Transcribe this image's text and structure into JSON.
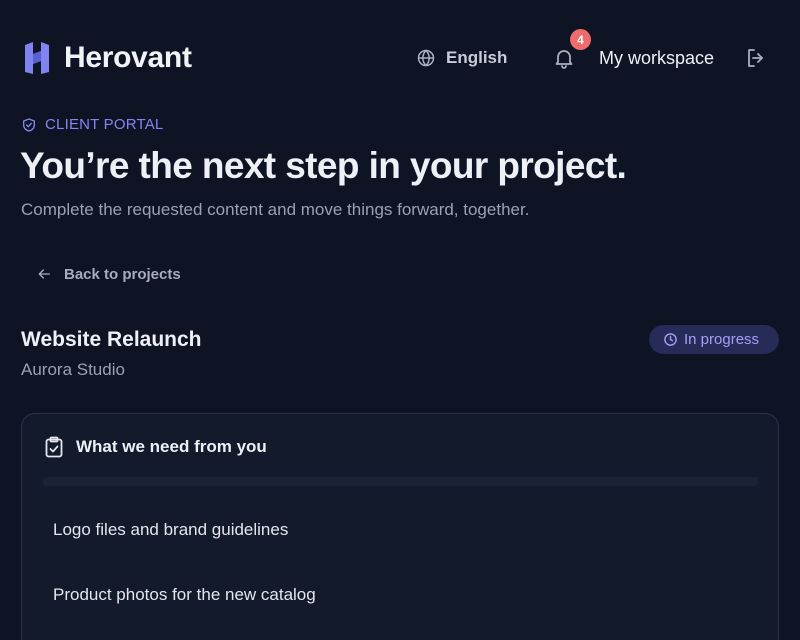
{
  "header": {
    "brand": "Herovant",
    "language": "English",
    "notifications_count": "4",
    "workspace_label": "My workspace"
  },
  "hero": {
    "eyebrow": "CLIENT PORTAL",
    "title": "You’re the next step in your project.",
    "subtitle": "Complete the requested content and move things forward, together."
  },
  "nav": {
    "back_label": "Back to projects"
  },
  "project": {
    "name": "Website Relaunch",
    "client": "Aurora Studio",
    "status": "In progress"
  },
  "requests_card": {
    "title": "What we need from you",
    "items": [
      {
        "label": "Logo files and brand guidelines"
      },
      {
        "label": "Product photos for the new catalog"
      }
    ]
  },
  "colors": {
    "background": "#0f1424",
    "accent": "#8286f2",
    "badge": "#f06b6b",
    "status_pill_bg": "#262b58"
  },
  "icons": {
    "logo": "h-logo-icon",
    "language": "globe-icon",
    "notifications": "bell-icon",
    "logout": "logout-icon",
    "eyebrow": "shield-check-icon",
    "back": "arrow-left-icon",
    "status": "clock-icon",
    "card": "clipboard-check-icon"
  }
}
